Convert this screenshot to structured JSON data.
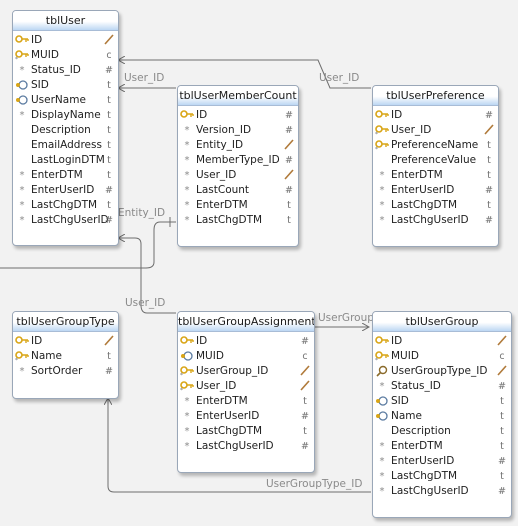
{
  "tables": [
    {
      "id": "tblUser",
      "title": "tblUser",
      "columns": [
        {
          "name": "ID",
          "icon": "key",
          "type": "/"
        },
        {
          "name": "MUID",
          "icon": "key-null",
          "type": "c"
        },
        {
          "name": "Status_ID",
          "icon": "null",
          "type": "#"
        },
        {
          "name": "SID",
          "icon": "index",
          "type": "t"
        },
        {
          "name": "UserName",
          "icon": "index",
          "type": "t"
        },
        {
          "name": "DisplayName",
          "icon": "null",
          "type": "t"
        },
        {
          "name": "Description",
          "icon": "none",
          "type": "t"
        },
        {
          "name": "EmailAddress",
          "icon": "none",
          "type": "t"
        },
        {
          "name": "LastLoginDTM",
          "icon": "none",
          "type": "t"
        },
        {
          "name": "EnterDTM",
          "icon": "null",
          "type": "t"
        },
        {
          "name": "EnterUserID",
          "icon": "null",
          "type": "#"
        },
        {
          "name": "LastChgDTM",
          "icon": "null",
          "type": "t"
        },
        {
          "name": "LastChgUserID",
          "icon": "null",
          "type": "#"
        }
      ]
    },
    {
      "id": "tblUserMemberCount",
      "title": "tblUserMemberCount",
      "columns": [
        {
          "name": "ID",
          "icon": "key",
          "type": "#"
        },
        {
          "name": "Version_ID",
          "icon": "null",
          "type": "#"
        },
        {
          "name": "Entity_ID",
          "icon": "null",
          "type": "/"
        },
        {
          "name": "MemberType_ID",
          "icon": "null",
          "type": "#"
        },
        {
          "name": "User_ID",
          "icon": "null",
          "type": "/"
        },
        {
          "name": "LastCount",
          "icon": "null",
          "type": "#"
        },
        {
          "name": "EnterDTM",
          "icon": "null",
          "type": "t"
        },
        {
          "name": "LastChgDTM",
          "icon": "null",
          "type": "t"
        }
      ]
    },
    {
      "id": "tblUserPreference",
      "title": "tblUserPreference",
      "columns": [
        {
          "name": "ID",
          "icon": "key",
          "type": "#"
        },
        {
          "name": "User_ID",
          "icon": "key-null",
          "type": "/"
        },
        {
          "name": "PreferenceName",
          "icon": "key-null",
          "type": "t"
        },
        {
          "name": "PreferenceValue",
          "icon": "none",
          "type": "t"
        },
        {
          "name": "EnterDTM",
          "icon": "null",
          "type": "t"
        },
        {
          "name": "EnterUserID",
          "icon": "null",
          "type": "#"
        },
        {
          "name": "LastChgDTM",
          "icon": "null",
          "type": "t"
        },
        {
          "name": "LastChgUserID",
          "icon": "null",
          "type": "#"
        }
      ]
    },
    {
      "id": "tblUserGroupType",
      "title": "tblUserGroupType",
      "columns": [
        {
          "name": "ID",
          "icon": "key",
          "type": "/"
        },
        {
          "name": "Name",
          "icon": "key-null",
          "type": "t"
        },
        {
          "name": "SortOrder",
          "icon": "null",
          "type": "#"
        }
      ]
    },
    {
      "id": "tblUserGroupAssignment",
      "title": "tblUserGroupAssignment",
      "columns": [
        {
          "name": "ID",
          "icon": "key",
          "type": "#"
        },
        {
          "name": "MUID",
          "icon": "index",
          "type": "c"
        },
        {
          "name": "UserGroup_ID",
          "icon": "key-null",
          "type": "/"
        },
        {
          "name": "User_ID",
          "icon": "key-null",
          "type": "/"
        },
        {
          "name": "EnterDTM",
          "icon": "null",
          "type": "t"
        },
        {
          "name": "EnterUserID",
          "icon": "null",
          "type": "#"
        },
        {
          "name": "LastChgDTM",
          "icon": "null",
          "type": "t"
        },
        {
          "name": "LastChgUserID",
          "icon": "null",
          "type": "#"
        }
      ]
    },
    {
      "id": "tblUserGroup",
      "title": "tblUserGroup",
      "columns": [
        {
          "name": "ID",
          "icon": "key",
          "type": "/"
        },
        {
          "name": "MUID",
          "icon": "key-null",
          "type": "c"
        },
        {
          "name": "UserGroupType_ID",
          "icon": "search",
          "type": "/"
        },
        {
          "name": "Status_ID",
          "icon": "null",
          "type": "#"
        },
        {
          "name": "SID",
          "icon": "index",
          "type": "t"
        },
        {
          "name": "Name",
          "icon": "index",
          "type": "t"
        },
        {
          "name": "Description",
          "icon": "none",
          "type": "t"
        },
        {
          "name": "EnterDTM",
          "icon": "null",
          "type": "t"
        },
        {
          "name": "EnterUserID",
          "icon": "null",
          "type": "#"
        },
        {
          "name": "LastChgDTM",
          "icon": "null",
          "type": "t"
        },
        {
          "name": "LastChgUserID",
          "icon": "null",
          "type": "#"
        }
      ]
    }
  ],
  "relationship_labels": {
    "user_id_member_count": "User_ID",
    "user_id_preference": "User_ID",
    "entity_id": "Entity_ID",
    "user_id_assignment": "User_ID",
    "user_group": "UserGroup",
    "user_group_type_id": "UserGroupType_ID"
  },
  "colors": {
    "title_gradient": "#bcd7f3",
    "border": "#9aa7b8",
    "line": "#707070",
    "key": "#d9a516"
  }
}
